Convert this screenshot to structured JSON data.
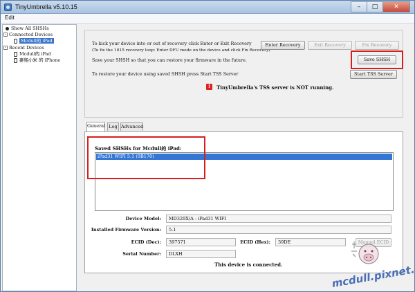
{
  "window": {
    "title": "TinyUmbrella v5.10.15"
  },
  "menu": {
    "edit": "Edit"
  },
  "tree": {
    "show_all": "Show All SHSHs",
    "connected_devices": "Connected Devices",
    "connected_item": "Mcdull的 iPad",
    "recent_devices": "Recent Devices",
    "recent_items": [
      "Mcdull的 iPad",
      "麥兜小米 的 iPhone"
    ]
  },
  "top": {
    "line1": "To kick your device into or out of recovery click Enter or Exit Recovery",
    "line2": "(To fix the 1015 recovery loop: Enter DFU mode on the device and click Fix Recovery)",
    "line3": "Save your SHSH so that you can restore your firmware in the future.",
    "line4": "To restore your device using saved SHSH press Start TSS Server",
    "enter_recovery": "Enter Recovery",
    "exit_recovery": "Exit Recovery",
    "fix_recovery": "Fix Recovery",
    "save_shsh": "Save SHSH",
    "start_tss": "Start TSS Server",
    "tss_status": "TinyUmbrella's TSS server is NOT running."
  },
  "tabs": [
    "General",
    "Log",
    "Advanced"
  ],
  "general": {
    "saved_label": "Saved SHSHs for Mcdull的 iPad:",
    "saved_items": [
      "iPad31 WIFI 5.1 (9B176)"
    ],
    "device_model_label": "Device Model:",
    "device_model": "MD329X/A - iPad31 WIFI",
    "firmware_label": "Installed Firmware Version:",
    "firmware": "5.1",
    "ecid_dec_label": "ECID (Dec):",
    "ecid_dec": "397571",
    "ecid_hex_label": "ECID (Hex):",
    "ecid_hex": "39DE",
    "serial_label": "Serial Number:",
    "serial": "DLXH",
    "connected_status": "This device is connected.",
    "ecid_button": "Manual ECID"
  },
  "watermark": {
    "text": "mcdull.pixnet.net"
  },
  "colors": {
    "highlight": "#d71e1e",
    "selection": "#3376d3"
  }
}
